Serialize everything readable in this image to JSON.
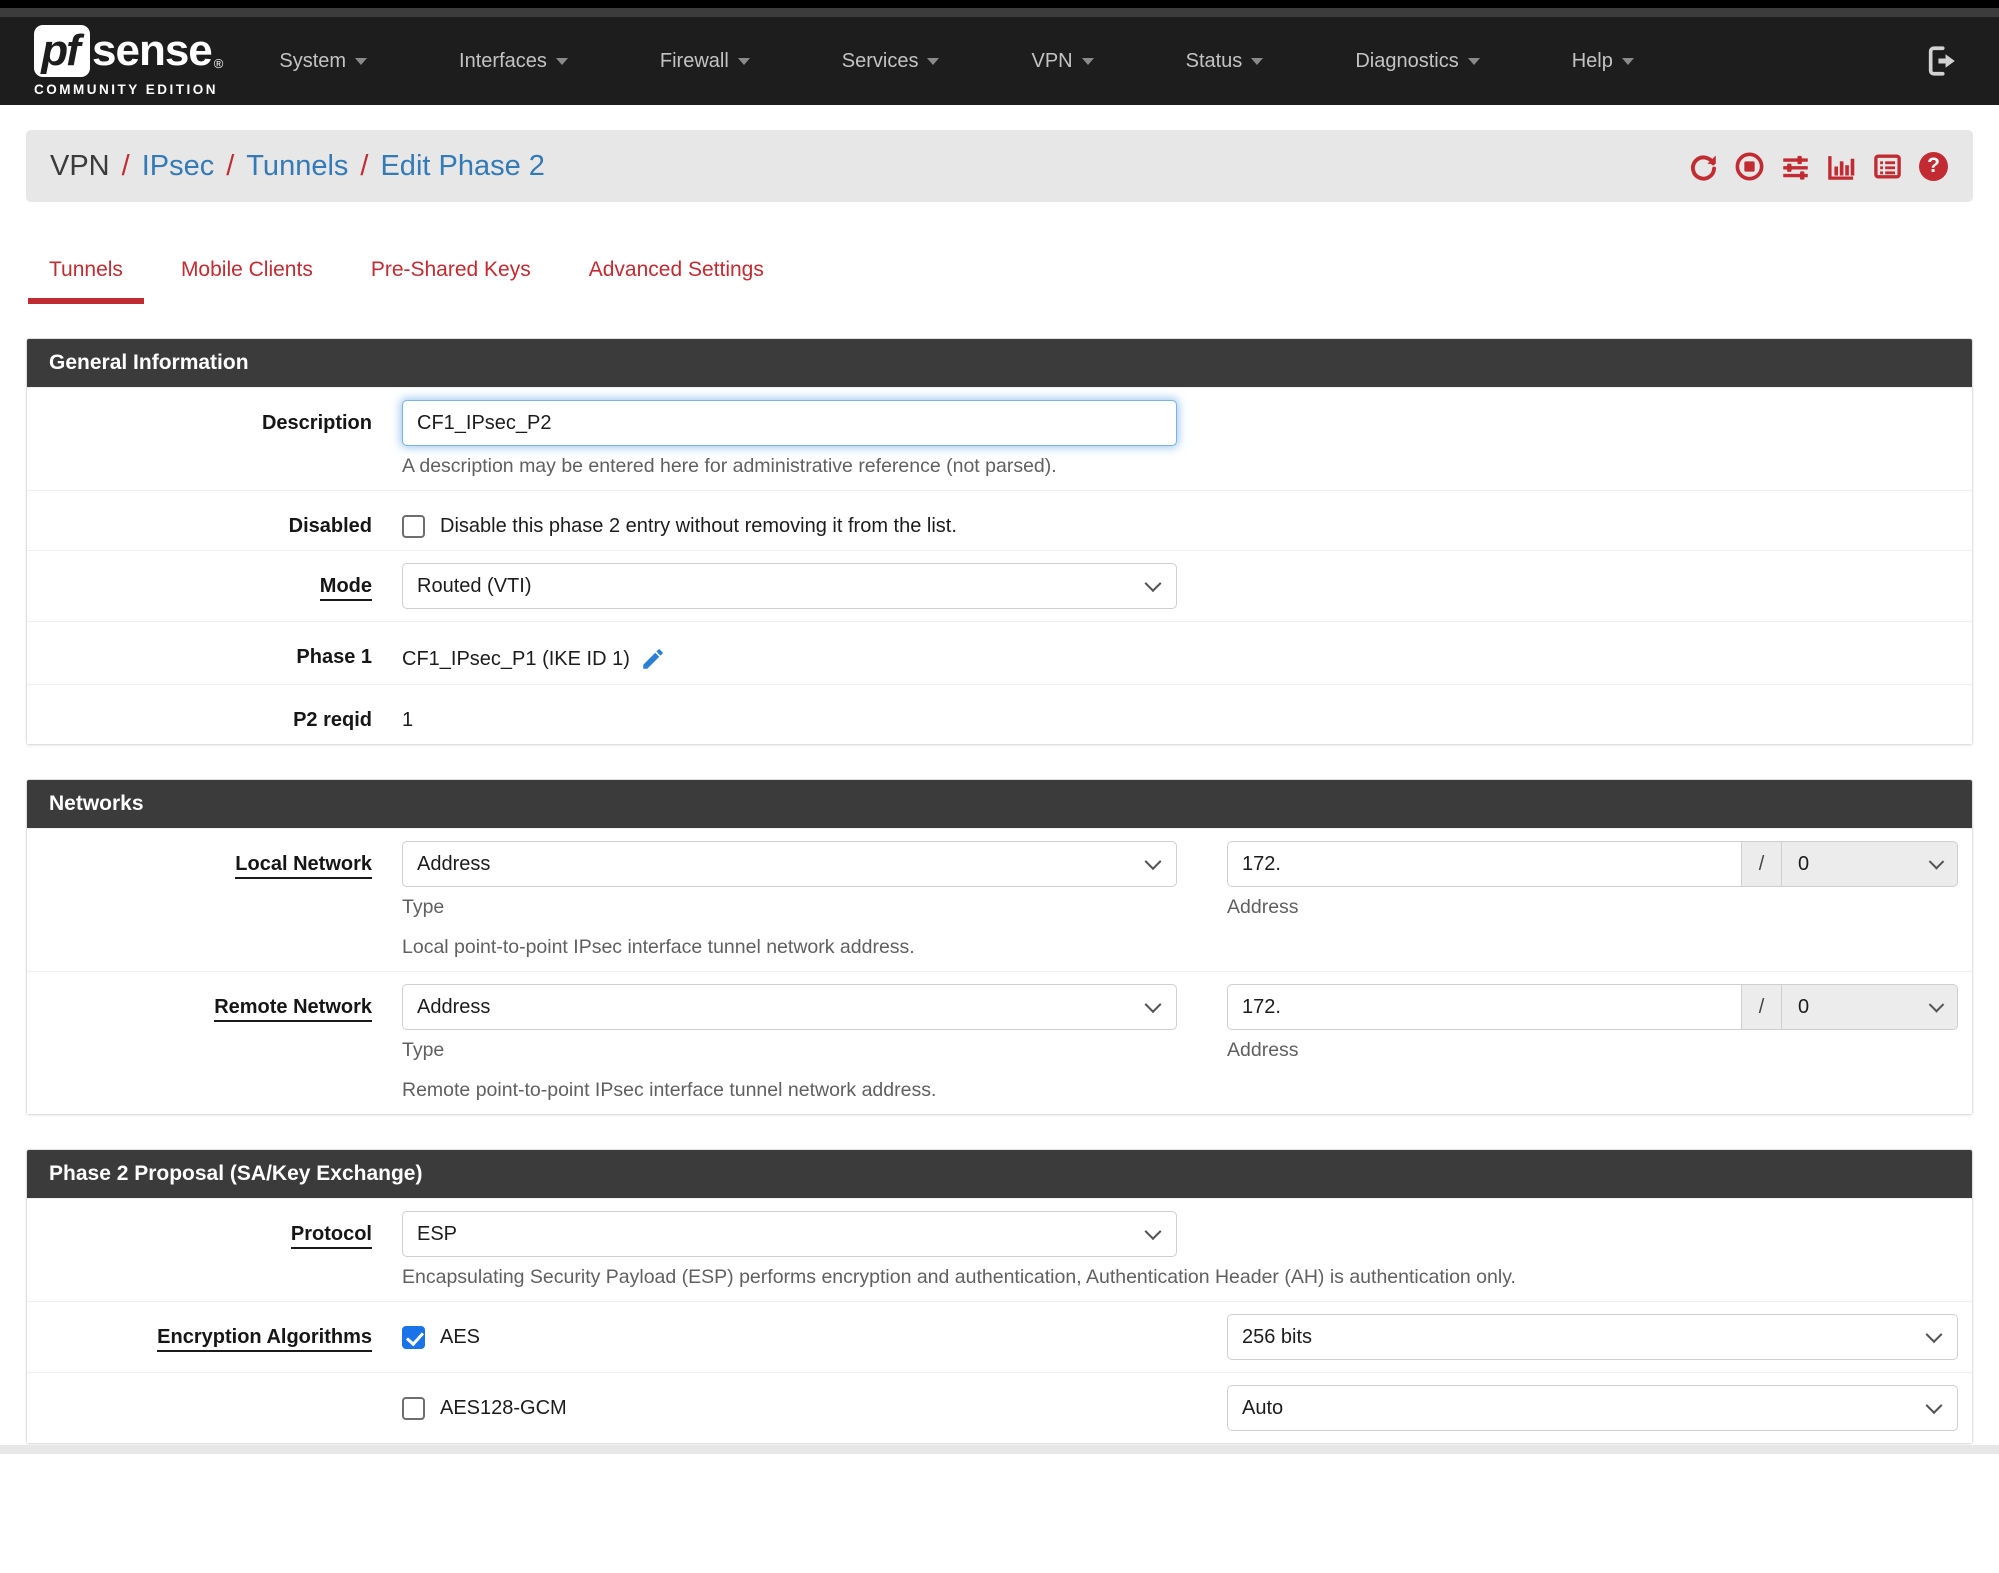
{
  "colors": {
    "accent_red": "#c22b31",
    "link_blue": "#337ab7",
    "checkbox_blue": "#1a73e8",
    "panel_header_bg": "#3b3b3b",
    "navbar_bg": "#1d1d1e"
  },
  "navbar": {
    "logo": {
      "prefix": "pf",
      "name": "sense",
      "registered": "®",
      "subtitle": "COMMUNITY EDITION"
    },
    "items": [
      {
        "label": "System"
      },
      {
        "label": "Interfaces"
      },
      {
        "label": "Firewall"
      },
      {
        "label": "Services"
      },
      {
        "label": "VPN"
      },
      {
        "label": "Status"
      },
      {
        "label": "Diagnostics"
      },
      {
        "label": "Help"
      }
    ]
  },
  "breadcrumb": {
    "root": "VPN",
    "separator": "/",
    "links": [
      {
        "label": "IPsec"
      },
      {
        "label": "Tunnels"
      },
      {
        "label": "Edit Phase 2"
      }
    ],
    "icons": [
      "refresh-icon",
      "stop-circle-icon",
      "sliders-icon",
      "bar-chart-icon",
      "log-list-icon",
      "help-icon"
    ],
    "help_glyph": "?"
  },
  "tabs": [
    {
      "label": "Tunnels",
      "active": true
    },
    {
      "label": "Mobile Clients",
      "active": false
    },
    {
      "label": "Pre-Shared Keys",
      "active": false
    },
    {
      "label": "Advanced Settings",
      "active": false
    }
  ],
  "general": {
    "title": "General Information",
    "description": {
      "label": "Description",
      "value": "CF1_IPsec_P2",
      "help": "A description may be entered here for administrative reference (not parsed)."
    },
    "disabled": {
      "label": "Disabled",
      "checkbox_label": "Disable this phase 2 entry without removing it from the list.",
      "checked": false
    },
    "mode": {
      "label": "Mode",
      "value": "Routed (VTI)"
    },
    "phase1": {
      "label": "Phase 1",
      "value": "CF1_IPsec_P1 (IKE ID 1)"
    },
    "p2reqid": {
      "label": "P2 reqid",
      "value": "1"
    }
  },
  "networks": {
    "title": "Networks",
    "local": {
      "label": "Local Network",
      "type_value": "Address",
      "type_caption": "Type",
      "address_value": "172.",
      "separator": "/",
      "mask_value": "0",
      "address_caption": "Address",
      "help": "Local point-to-point IPsec interface tunnel network address."
    },
    "remote": {
      "label": "Remote Network",
      "type_value": "Address",
      "type_caption": "Type",
      "address_value": "172.",
      "separator": "/",
      "mask_value": "0",
      "address_caption": "Address",
      "help": "Remote point-to-point IPsec interface tunnel network address."
    }
  },
  "proposal": {
    "title": "Phase 2 Proposal (SA/Key Exchange)",
    "protocol": {
      "label": "Protocol",
      "value": "ESP",
      "help": "Encapsulating Security Payload (ESP) performs encryption and authentication, Authentication Header (AH) is authentication only."
    },
    "encryption": {
      "label": "Encryption Algorithms",
      "rows": [
        {
          "name": "AES",
          "checked": true,
          "bits": "256 bits"
        },
        {
          "name": "AES128-GCM",
          "checked": false,
          "bits": "Auto"
        }
      ]
    }
  }
}
